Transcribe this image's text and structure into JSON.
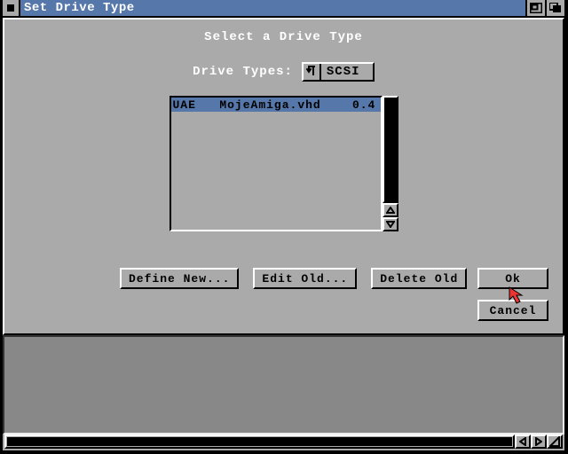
{
  "window": {
    "title": "Set Drive Type"
  },
  "dialog": {
    "heading": "Select a Drive Type",
    "types_label": "Drive Types:",
    "types_value": "SCSI"
  },
  "list": {
    "items": [
      {
        "col1": "UAE",
        "col2": "MojeAmiga.vhd",
        "col3": "0.4"
      }
    ]
  },
  "buttons": {
    "define_new": "Define New...",
    "edit_old": "Edit Old...",
    "delete_old": "Delete Old",
    "ok": "Ok",
    "cancel": "Cancel"
  }
}
